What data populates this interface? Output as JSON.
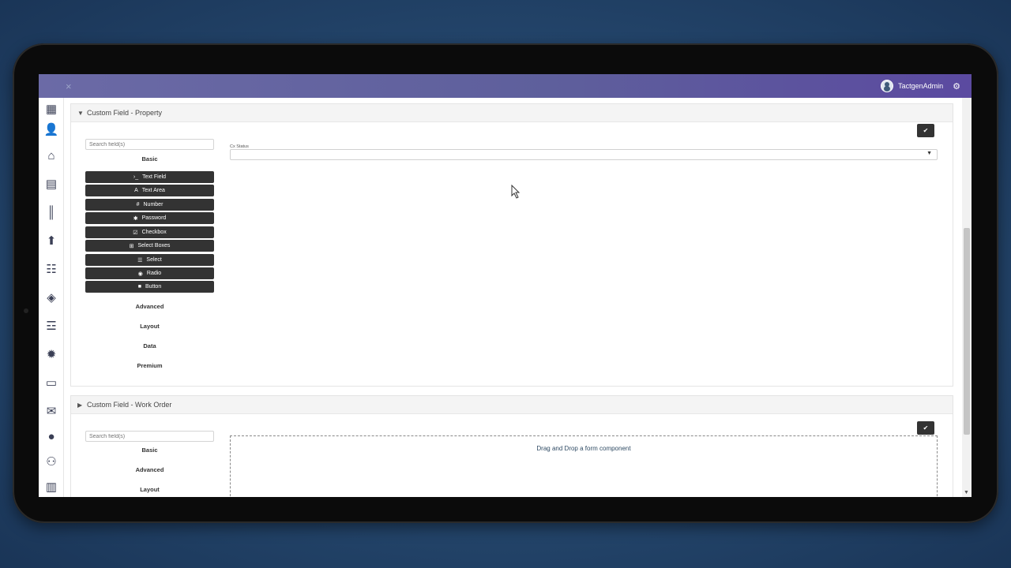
{
  "topbar": {
    "close_icon": "×",
    "username": "TactgenAdmin"
  },
  "sidebar": {
    "icons": [
      "dashboard-settings",
      "add-user",
      "property-settings",
      "building-settings",
      "meter",
      "upload",
      "checklist",
      "tag",
      "form-settings",
      "badge-settings",
      "monitor",
      "mail",
      "user",
      "users",
      "building"
    ]
  },
  "panels": [
    {
      "title": "Custom Field - Property",
      "search_placeholder": "Search field(s)",
      "basic_label": "Basic",
      "components": [
        {
          "icon": "›_",
          "label": "Text Field"
        },
        {
          "icon": "A",
          "label": "Text Area"
        },
        {
          "icon": "#",
          "label": "Number"
        },
        {
          "icon": "✱",
          "label": "Password"
        },
        {
          "icon": "☑",
          "label": "Checkbox"
        },
        {
          "icon": "⊞",
          "label": "Select Boxes"
        },
        {
          "icon": "☰",
          "label": "Select"
        },
        {
          "icon": "◉",
          "label": "Radio"
        },
        {
          "icon": "■",
          "label": "Button"
        }
      ],
      "groups": [
        "Advanced",
        "Layout",
        "Data",
        "Premium"
      ],
      "field_label": "Cx Status",
      "ok_icon": "✔"
    },
    {
      "title": "Custom Field - Work Order",
      "search_placeholder": "Search field(s)",
      "groups": [
        "Basic",
        "Advanced",
        "Layout"
      ],
      "dropzone_text": "Drag and Drop a form component",
      "ok_icon": "✔"
    }
  ]
}
